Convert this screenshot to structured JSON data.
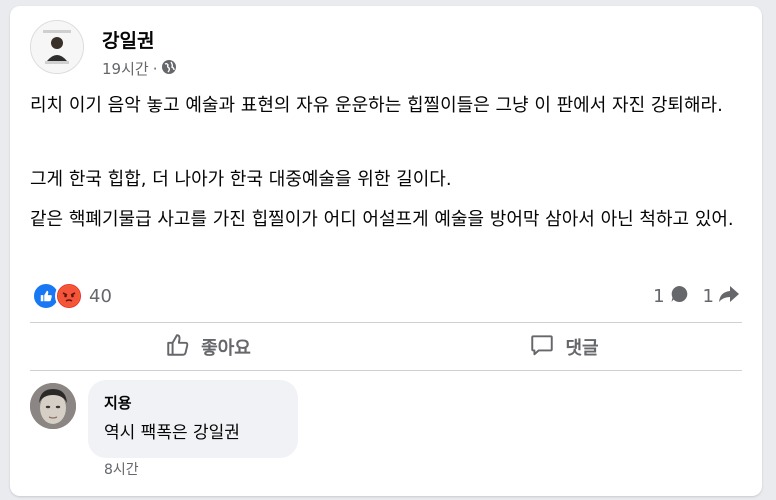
{
  "post": {
    "author": "강일권",
    "time": "19시간",
    "separator": "·",
    "privacy_icon": "globe-icon",
    "paragraphs": [
      "리치 이기 음악 놓고 예술과 표현의 자유 운운하는 힙찔이들은 그냥 이 판에서 자진 강퇴해라.",
      "그게 한국 힙합, 더 나아가 한국 대중예술을 위한 길이다.",
      "같은 핵폐기물급 사고를 가진 힙찔이가 어디 어설프게 예술을 방어막 삼아서 아닌 척하고 있어."
    ]
  },
  "reactions": {
    "icons": [
      "like-icon",
      "angry-icon"
    ],
    "count": "40",
    "comments_count": "1",
    "shares_count": "1"
  },
  "actions": {
    "like_label": "좋아요",
    "comment_label": "댓글"
  },
  "comment": {
    "author": "지용",
    "text": "역시 팩폭은 강일권",
    "time": "8시간"
  },
  "colors": {
    "like_blue": "#1877f2",
    "angry_red": "#f02849",
    "secondary_text": "#65676b"
  }
}
